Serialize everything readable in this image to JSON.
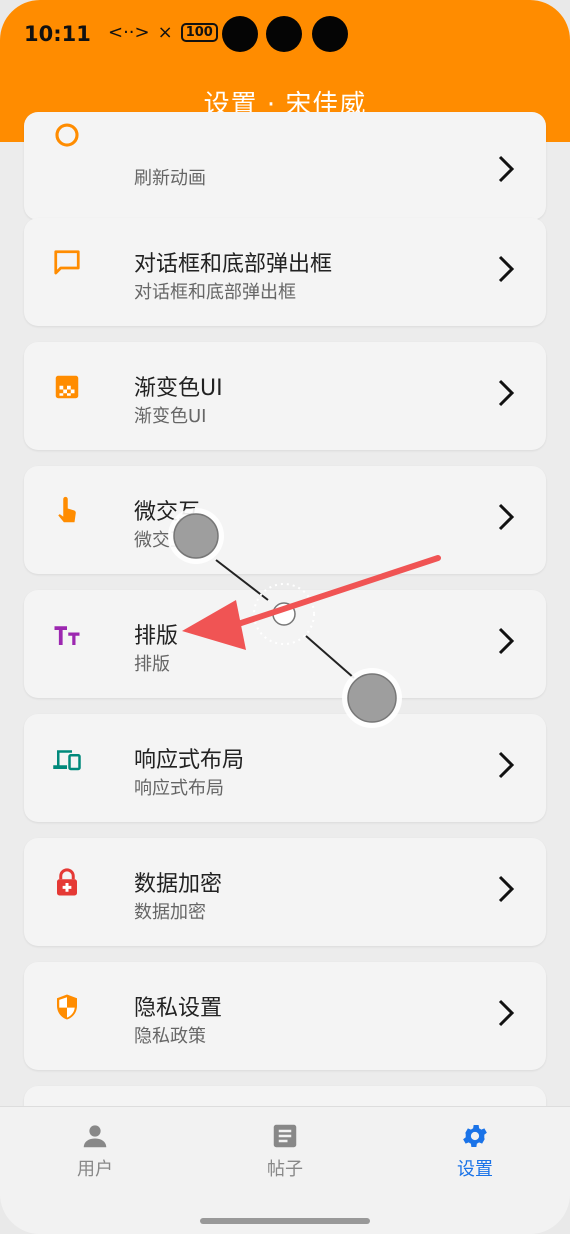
{
  "status": {
    "time": "10:11",
    "battery": "100",
    "signal": "<··>",
    "x_mark": "×"
  },
  "header": {
    "title": "设置 · 宋佳威"
  },
  "items": [
    {
      "title": "",
      "subtitle": "刷新动画",
      "icon": "refresh-icon"
    },
    {
      "title": "对话框和底部弹出框",
      "subtitle": "对话框和底部弹出框",
      "icon": "chat-icon"
    },
    {
      "title": "渐变色UI",
      "subtitle": "渐变色UI",
      "icon": "gradient-icon"
    },
    {
      "title": "微交互",
      "subtitle": "微交互",
      "icon": "touch-icon"
    },
    {
      "title": "排版",
      "subtitle": "排版",
      "icon": "typography-icon"
    },
    {
      "title": "响应式布局",
      "subtitle": "响应式布局",
      "icon": "devices-icon"
    },
    {
      "title": "数据加密",
      "subtitle": "数据加密",
      "icon": "lock-icon"
    },
    {
      "title": "隐私设置",
      "subtitle": "隐私政策",
      "icon": "shield-icon"
    }
  ],
  "nav": [
    {
      "label": "用户",
      "icon": "person-icon"
    },
    {
      "label": "帖子",
      "icon": "article-icon"
    },
    {
      "label": "设置",
      "icon": "gear-icon",
      "active": true
    }
  ],
  "colors": {
    "header": "#ff8c00",
    "active": "#1a73e8",
    "annotation_arrow": "#f05454"
  }
}
